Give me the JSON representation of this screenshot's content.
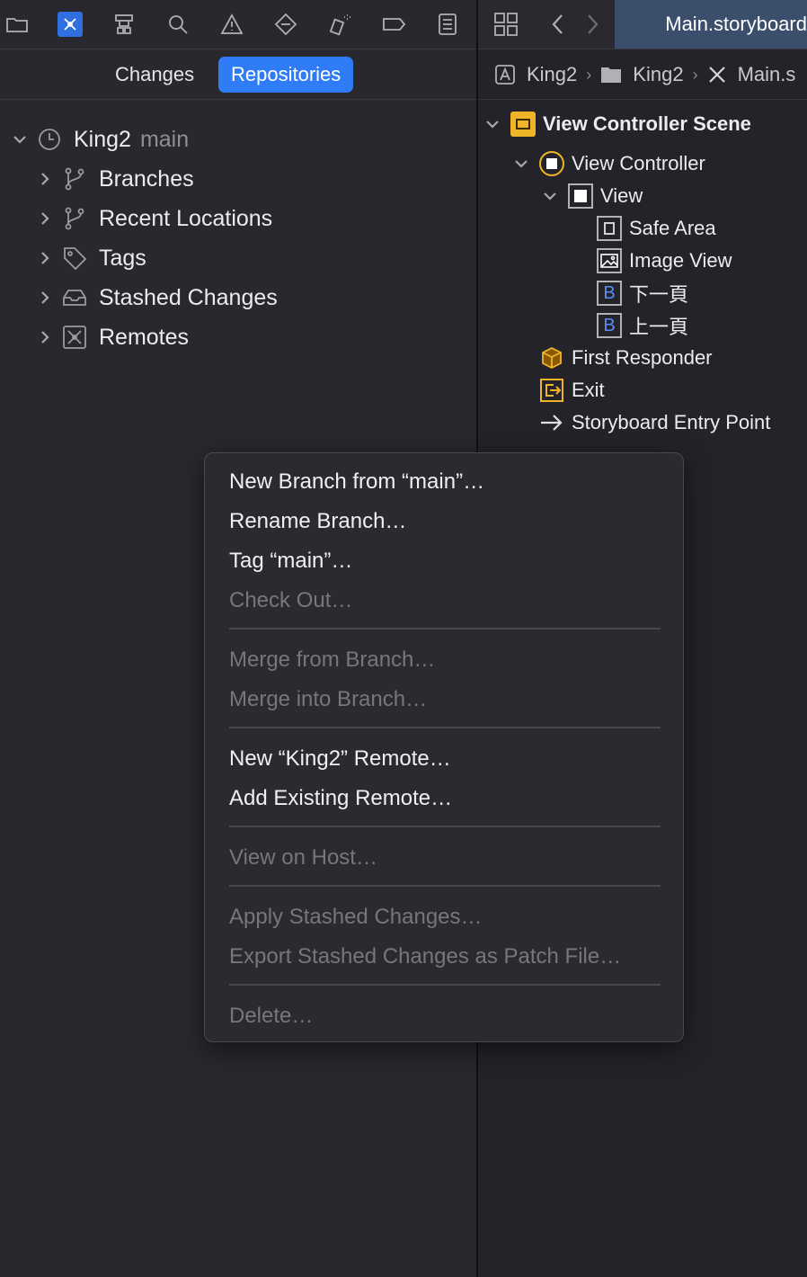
{
  "navigator": {
    "segments": [
      "Changes",
      "Repositories"
    ],
    "selected_segment": "Repositories",
    "repo": {
      "name": "King2",
      "branch": "main"
    },
    "items": [
      {
        "label": "Branches",
        "icon": "branch-icon"
      },
      {
        "label": "Recent Locations",
        "icon": "branch-icon"
      },
      {
        "label": "Tags",
        "icon": "tag-icon"
      },
      {
        "label": "Stashed Changes",
        "icon": "tray-icon"
      },
      {
        "label": "Remotes",
        "icon": "remote-icon"
      }
    ]
  },
  "editor": {
    "tab_title": "Main.storyboard",
    "breadcrumbs": [
      "King2",
      "King2",
      "Main.s"
    ]
  },
  "outline": {
    "scene": "View Controller Scene",
    "view_controller": "View Controller",
    "view": "View",
    "children": [
      {
        "label": "Safe Area",
        "icon": "safe-area-icon"
      },
      {
        "label": "Image View",
        "icon": "image-icon"
      },
      {
        "label": "下一頁",
        "icon": "button-icon",
        "glyph": "B"
      },
      {
        "label": "上一頁",
        "icon": "button-icon",
        "glyph": "B"
      }
    ],
    "first_responder": "First Responder",
    "exit": "Exit",
    "entry_point": "Storyboard Entry Point"
  },
  "context_menu": {
    "items": [
      {
        "label": "New Branch from “main”…",
        "enabled": true
      },
      {
        "label": "Rename Branch…",
        "enabled": true
      },
      {
        "label": "Tag “main”…",
        "enabled": true
      },
      {
        "label": "Check Out…",
        "enabled": false
      },
      {
        "label": "Merge from Branch…",
        "enabled": false
      },
      {
        "label": "Merge into Branch…",
        "enabled": false
      },
      {
        "label": "New “King2” Remote…",
        "enabled": true
      },
      {
        "label": "Add Existing Remote…",
        "enabled": true
      },
      {
        "label": "View on Host…",
        "enabled": false
      },
      {
        "label": "Apply Stashed Changes…",
        "enabled": false
      },
      {
        "label": "Export Stashed Changes as Patch File…",
        "enabled": false
      },
      {
        "label": "Delete…",
        "enabled": false
      }
    ]
  },
  "colors": {
    "accent": "#2f7cf6",
    "disabled": "#76767c",
    "storyboard_yellow": "#f0b429"
  }
}
